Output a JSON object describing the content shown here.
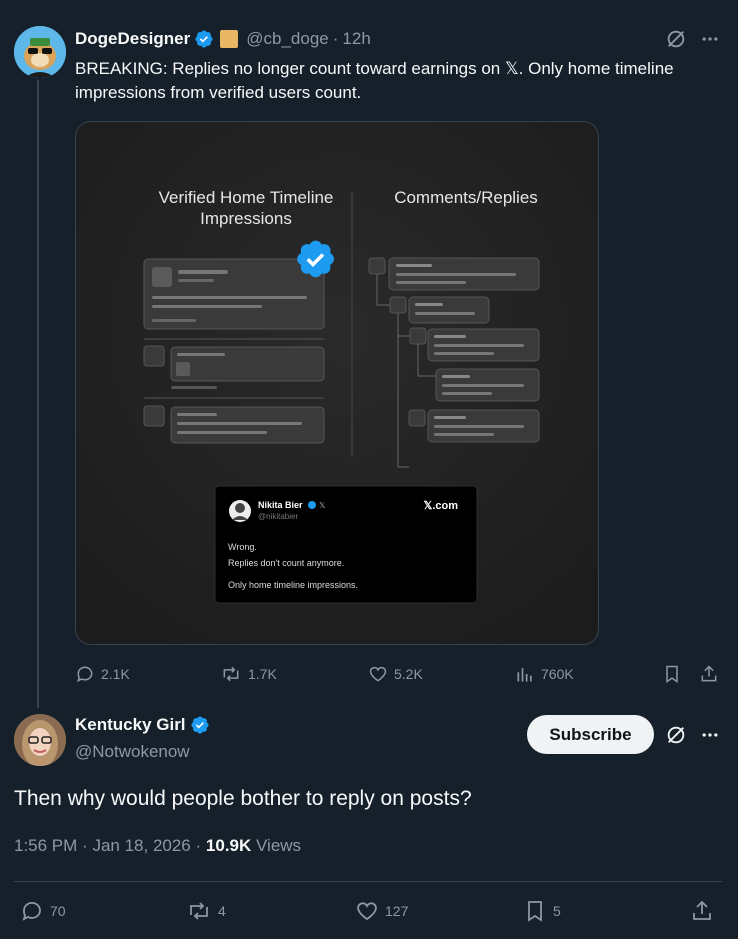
{
  "post": {
    "author_name": "DogeDesigner",
    "author_handle": "@cb_doge",
    "separator": "·",
    "time_ago": "12h",
    "text": "BREAKING: Replies no longer count toward earnings on 𝕏. Only home timeline impressions from verified users count.",
    "media": {
      "left_title_line1": "Verified Home Timeline",
      "left_title_line2": "Impressions",
      "right_title": "Comments/Replies",
      "card": {
        "name": "Nikita Bier",
        "handle": "@nikitabier",
        "site": "𝕏.com",
        "line1": "Wrong.",
        "line2": "Replies don't count anymore.",
        "line3": "Only home timeline impressions."
      }
    },
    "actions": {
      "replies": "2.1K",
      "reposts": "1.7K",
      "likes": "5.2K",
      "views": "760K"
    }
  },
  "reply": {
    "author_name": "Kentucky Girl",
    "author_handle": "@Notwokenow",
    "subscribe_label": "Subscribe",
    "text": "Then why would people bother to reply on posts?",
    "time": "1:56 PM",
    "separator": "·",
    "date": "Jan 18, 2026",
    "views_count": "10.9K",
    "views_label": "Views",
    "actions": {
      "replies": "70",
      "reposts": "4",
      "likes": "127",
      "bookmarks": "5"
    }
  },
  "colors": {
    "background": "#15202b",
    "secondary_text": "#8b98a5",
    "verified_blue": "#1d9bf0",
    "border": "#38444d"
  }
}
